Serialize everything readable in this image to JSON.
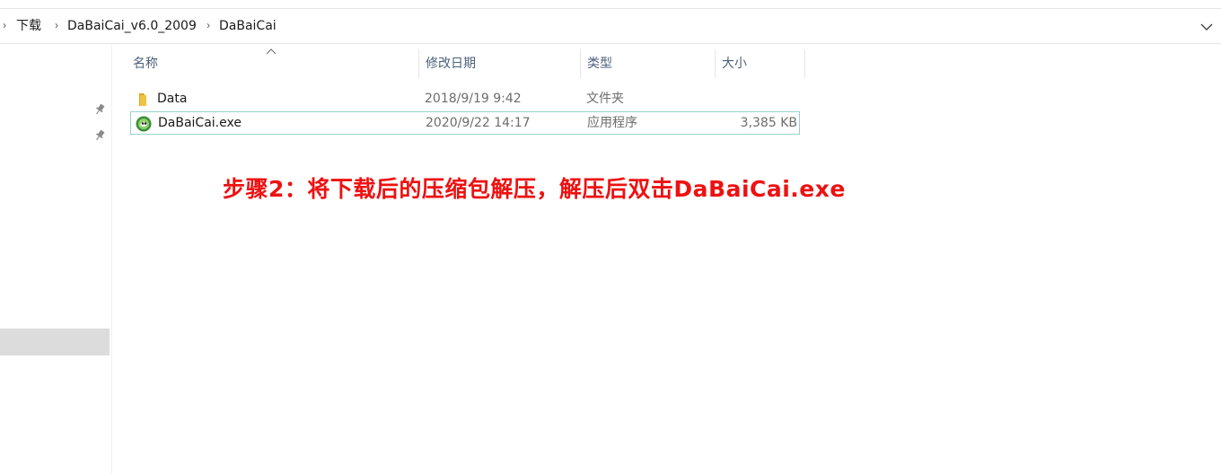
{
  "breadcrumb": {
    "items": [
      "下载",
      "DaBaiCai_v6.0_2009",
      "DaBaiCai"
    ]
  },
  "columns": {
    "name": "名称",
    "modified": "修改日期",
    "type": "类型",
    "size": "大小"
  },
  "files": [
    {
      "name": "Data",
      "modified": "2018/9/19 9:42",
      "type": "文件夹",
      "size": "",
      "icon": "folder-icon"
    },
    {
      "name": "DaBaiCai.exe",
      "modified": "2020/9/22 14:17",
      "type": "应用程序",
      "size": "3,385 KB",
      "icon": "app-icon",
      "selected": true
    }
  ],
  "annotation": {
    "text": "步骤2：将下载后的压缩包解压，解压后双击DaBaiCai.exe",
    "color": "#ee1111"
  },
  "colors": {
    "selection_border": "#99d1cc",
    "header_text": "#4c607a",
    "folder": "#e8b93a"
  }
}
